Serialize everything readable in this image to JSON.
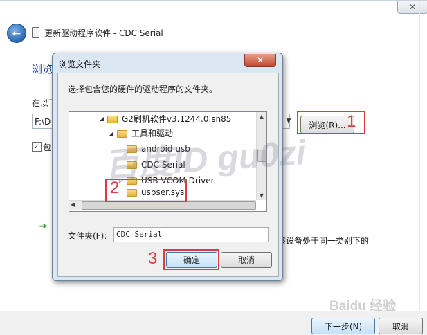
{
  "wizard": {
    "title": "更新驱动程序软件 - CDC Serial",
    "close_glyph": "✕",
    "back_glyph": "←",
    "heading": "浏览",
    "search_label": "在以下",
    "path_value": "F:\\D",
    "browse_label": "浏览(R)...",
    "include_subfolders_label": "包",
    "include_subfolders_checked": true,
    "pick_text": "该设备处于同一类别下的",
    "next_label": "下一步(N)",
    "cancel_label": "取消"
  },
  "dialog": {
    "title": "浏览文件夹",
    "close_glyph": "✕",
    "instruction": "选择包含您的硬件的驱动程序的文件夹。",
    "tree": [
      {
        "label": "G2刷机软件v3.1244.0.sn85",
        "expander": "◢"
      },
      {
        "label": "工具和驱动",
        "expander": "◢"
      },
      {
        "label": "android usb",
        "expander": ""
      },
      {
        "label": "CDC Serial",
        "expander": ""
      },
      {
        "label": "USB VCOM Driver",
        "expander": "▷"
      },
      {
        "label": "usbser.sys",
        "expander": ""
      }
    ],
    "folder_label": "文件夹(F):",
    "folder_value": "CDC Serial",
    "ok_label": "确定",
    "cancel_label": "取消"
  },
  "annotations": {
    "step1": "1",
    "step2": "2",
    "step3": "3",
    "color": "#e03a3e"
  },
  "watermarks": {
    "author": "百度ID gu0zi",
    "baidu": "Baidu 经验"
  }
}
